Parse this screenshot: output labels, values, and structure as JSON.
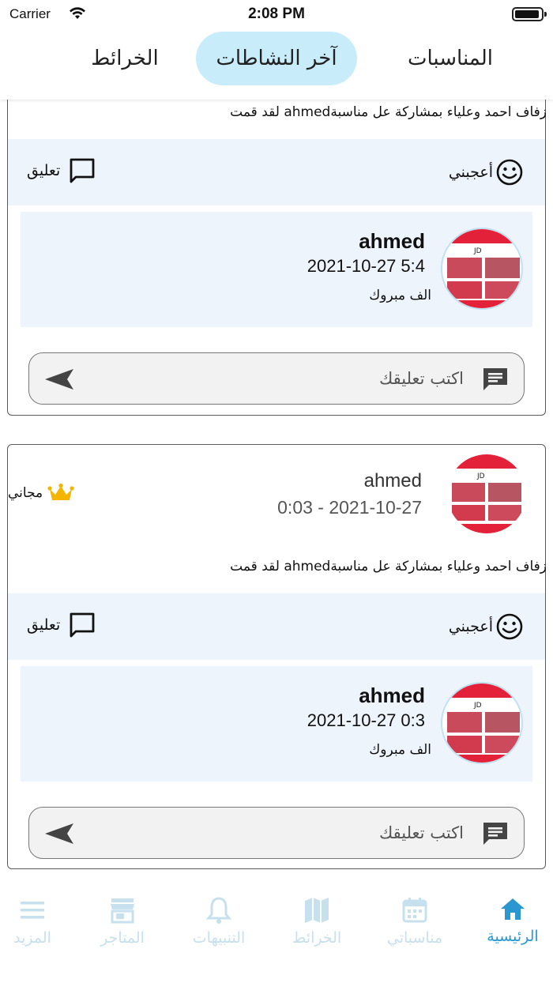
{
  "status": {
    "carrier": "Carrier",
    "time": "2:08 PM"
  },
  "tabs": [
    {
      "label": "المناسبات"
    },
    {
      "label": "آخر النشاطات",
      "active": true
    },
    {
      "label": "الخرائط"
    }
  ],
  "colors": {
    "accent": "#2a97d1",
    "tab_active_bg": "#c9ecfb",
    "section_bg": "#eef4fb",
    "inactive_nav": "#c7e0ee"
  },
  "posts": [
    {
      "message": "زفاف احمد وعلياء بمشاركة  عل مناسبةahmed لقد قمت",
      "like_label": "أعجبني",
      "comment_label": "تعليق",
      "comment": {
        "author": "ahmed",
        "date": "2021-10-27 5:4",
        "text": "الف مبروك"
      },
      "input_placeholder": "اكتب تعليقك"
    },
    {
      "author": "ahmed",
      "date": "0:03 - 2021-10-27",
      "badge": "مجاني",
      "message": "زفاف احمد وعلياء بمشاركة  عل مناسبةahmed لقد قمت",
      "like_label": "أعجبني",
      "comment_label": "تعليق",
      "comment": {
        "author": "ahmed",
        "date": "2021-10-27 0:3",
        "text": "الف مبروك"
      },
      "input_placeholder": "اكتب تعليقك"
    }
  ],
  "bottom_nav": [
    {
      "label": "الرئيسية",
      "icon": "home-icon",
      "active": true
    },
    {
      "label": "مناسباتي",
      "icon": "calendar-icon"
    },
    {
      "label": "الخرائط",
      "icon": "map-icon"
    },
    {
      "label": "التنبيهات",
      "icon": "bell-icon"
    },
    {
      "label": "المتاجر",
      "icon": "store-icon"
    },
    {
      "label": "المزيد",
      "icon": "menu-icon"
    }
  ]
}
